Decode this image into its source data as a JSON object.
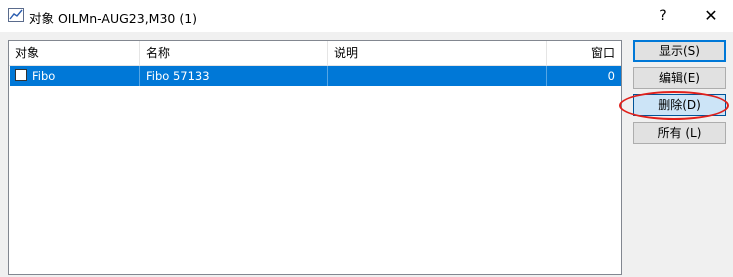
{
  "window": {
    "title": "对象 OILMn-AUG23,M30 (1)",
    "help_label": "?",
    "close_label": "✕"
  },
  "table": {
    "columns": [
      "对象",
      "名称",
      "说明",
      "窗口"
    ],
    "rows": [
      {
        "object": "Fibo",
        "name": "Fibo 57133",
        "description": "",
        "window": "0",
        "checked": false,
        "selected": true
      }
    ]
  },
  "buttons": {
    "show": "显示(S)",
    "edit": "编辑(E)",
    "delete": "删除(D)",
    "all": "所有 (L)"
  },
  "colors": {
    "selection": "#0078d7",
    "annotation": "#e0201b"
  }
}
